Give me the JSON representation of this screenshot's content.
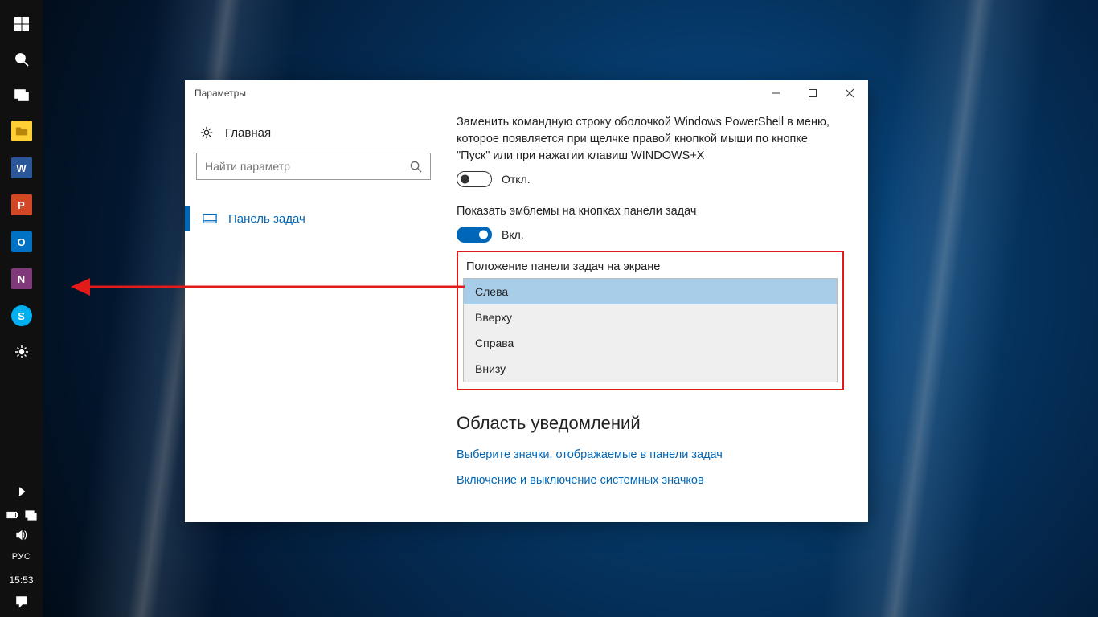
{
  "taskbar": {
    "apps": [
      {
        "name": "file-explorer",
        "bg": "#ffcf33",
        "letter": ""
      },
      {
        "name": "word",
        "bg": "#2b579a",
        "letter": "W"
      },
      {
        "name": "powerpoint",
        "bg": "#d24726",
        "letter": "P"
      },
      {
        "name": "outlook",
        "bg": "#0072c6",
        "letter": "O"
      },
      {
        "name": "onenote",
        "bg": "#80397b",
        "letter": "N"
      },
      {
        "name": "skype",
        "bg": "#00aff0",
        "letter": "S"
      }
    ],
    "lang": "РУС",
    "clock": "15:53"
  },
  "window": {
    "title": "Параметры",
    "home": "Главная",
    "search_placeholder": "Найти параметр",
    "nav_taskbar": "Панель задач"
  },
  "settings": {
    "powershell_text": "Заменить командную строку оболочкой Windows PowerShell в меню, которое появляется при щелчке правой кнопкой мыши по кнопке \"Пуск\" или при нажатии клавиш WINDOWS+X",
    "off_label": "Откл.",
    "badges_text": "Показать эмблемы на кнопках панели задач",
    "on_label": "Вкл.",
    "position_title": "Положение панели задач на экране",
    "position_options": [
      "Слева",
      "Вверху",
      "Справа",
      "Внизу"
    ],
    "notif_heading": "Область уведомлений",
    "link_icons": "Выберите значки, отображаемые в панели задач",
    "link_system": "Включение и выключение системных значков"
  }
}
